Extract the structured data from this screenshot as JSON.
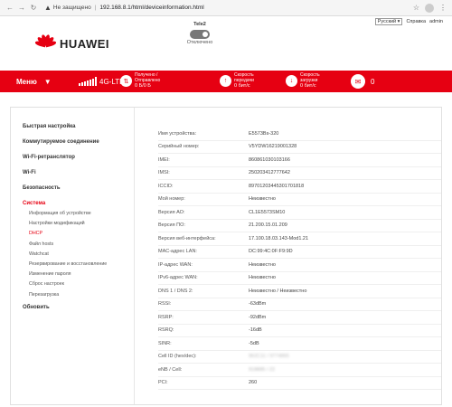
{
  "browser": {
    "security": "Не защищено",
    "url": "192.168.8.1/html/deviceinformation.html"
  },
  "header": {
    "language": "Русский",
    "help": "Справка",
    "user": "admin",
    "brand": "HUAWEI",
    "operator": "Tele2",
    "connection_state": "Отключено"
  },
  "statusbar": {
    "menu": "Меню",
    "network": "4G-LTE",
    "received_label": "Получено / Отправлено",
    "received_value": "0 Б/0 Б",
    "upload_label": "Скорость передачи",
    "upload_value": "0 бит/с",
    "download_label": "Скорость загрузки",
    "download_value": "0 бит/с",
    "messages_count": "0"
  },
  "sidebar": {
    "sections": [
      "Быстрая настройка",
      "Коммутируемое соединение",
      "Wi-Fi-ретранслятор",
      "Wi-Fi",
      "Безопасность",
      "Система"
    ],
    "system_items": [
      "Информация об устройстве",
      "Настройки модификаций",
      "DHCP",
      "Файл hosts",
      "Watchcat",
      "Резервирование и восстановление",
      "Изменение пароля",
      "Сброс настроек",
      "Перезагрузка"
    ],
    "update": "Обновить"
  },
  "device_info": [
    {
      "label": "Имя устройства:",
      "value": "E5573Bs-320"
    },
    {
      "label": "Серийный номер:",
      "value": "V5YDW16219001328"
    },
    {
      "label": "IMEI:",
      "value": "860861030103166"
    },
    {
      "label": "IMSI:",
      "value": "250203412777642"
    },
    {
      "label": "ICCID:",
      "value": "89701203445301701818"
    },
    {
      "label": "Мой номер:",
      "value": "Неизвестно"
    },
    {
      "label": "Версия АО:",
      "value": "CL1E5573SM10"
    },
    {
      "label": "Версия ПО:",
      "value": "21.200.15.01.209"
    },
    {
      "label": "Версия веб-интерфейса:",
      "value": "17.100.18.03.143-Mod1.21"
    },
    {
      "label": "MAC-адрес LAN:",
      "value": "DC:99:4C:0F:F9:9D"
    },
    {
      "label": "IP-адрес WAN:",
      "value": "Неизвестно"
    },
    {
      "label": "IPv6-адрес WAN:",
      "value": "Неизвестно"
    },
    {
      "label": "DNS 1 / DNS 2:",
      "value": "Неизвестно / Неизвестно"
    },
    {
      "label": "RSSI:",
      "value": "-63dBm"
    },
    {
      "label": "RSRP:",
      "value": "-92dBm"
    },
    {
      "label": "RSRQ:",
      "value": "-16dB"
    },
    {
      "label": "SINR:",
      "value": "-5dB"
    },
    {
      "label": "Cell ID (hex/dec):",
      "value": "962C11 / 9774865"
    },
    {
      "label": "eNB / Cell:",
      "value": "918885 / 22"
    },
    {
      "label": "PCI:",
      "value": "260"
    }
  ]
}
